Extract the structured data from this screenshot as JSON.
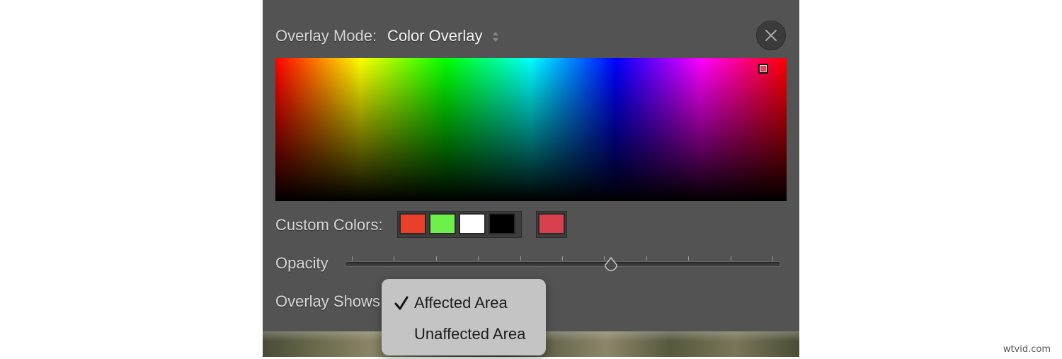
{
  "overlay_mode": {
    "label": "Overlay Mode:",
    "value": "Color Overlay"
  },
  "spectrum": {
    "selected_color": "#e0455a"
  },
  "custom_colors": {
    "label": "Custom Colors:",
    "swatches": [
      "#ea3f28",
      "#6ef04a",
      "#ffffff",
      "#000000"
    ],
    "current": "#d9404e"
  },
  "opacity": {
    "label": "Opacity",
    "value_fraction": 0.61,
    "tick_count": 11
  },
  "overlay_shows": {
    "label": "Overlay Shows:",
    "options": [
      {
        "label": "Affected Area",
        "checked": true
      },
      {
        "label": "Unaffected Area",
        "checked": false
      }
    ]
  },
  "icons": {
    "close": "close-icon",
    "stepper": "stepper-arrows-icon",
    "check": "checkmark-icon",
    "thumb": "slider-thumb-icon"
  },
  "watermark": "wtvid.com"
}
